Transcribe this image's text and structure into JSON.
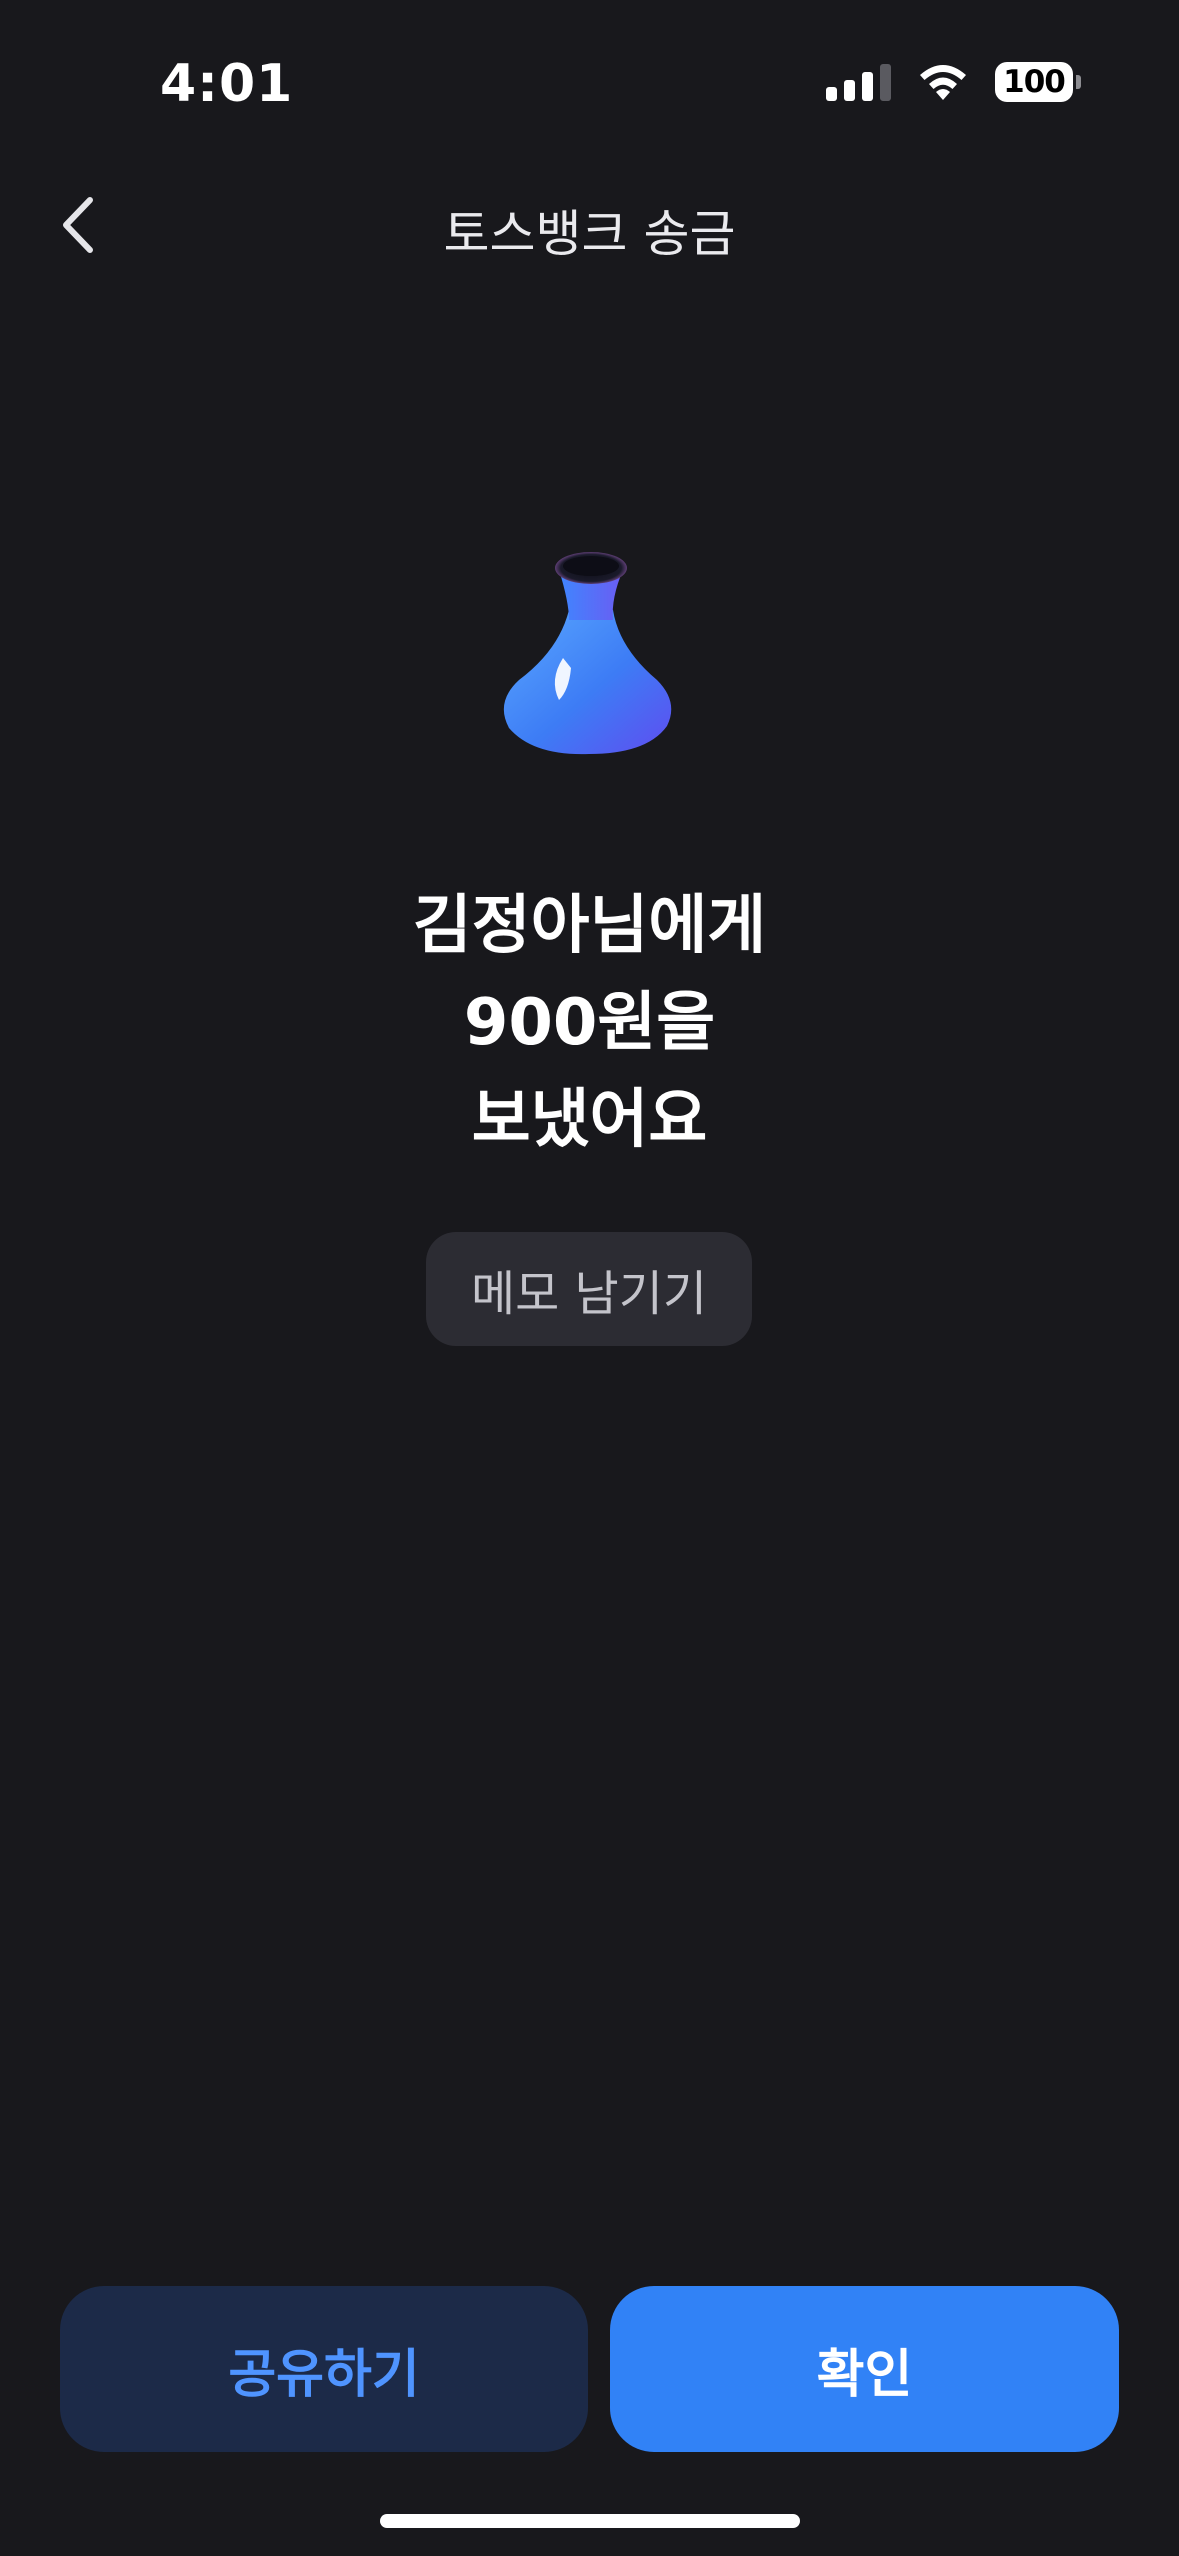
{
  "status_bar": {
    "time": "4:01",
    "battery": "100",
    "icons": [
      "signal-icon",
      "wifi-icon",
      "battery-icon"
    ]
  },
  "nav": {
    "title": "토스뱅크 송금",
    "back_icon": "chevron-left-icon"
  },
  "result": {
    "icon": "money-pouch-icon",
    "line1": "김정아님에게",
    "line2": "900원을",
    "line3": "보냈어요"
  },
  "memo": {
    "label": "메모 남기기"
  },
  "actions": {
    "share_label": "공유하기",
    "confirm_label": "확인"
  },
  "colors": {
    "background": "#18181c",
    "accent": "#3182f6",
    "share_bg": "#1c2a48",
    "share_text": "#4f94ff",
    "memo_bg": "#2c2c33"
  }
}
